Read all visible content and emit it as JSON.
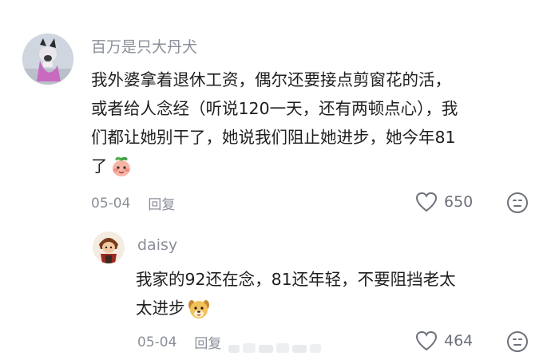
{
  "comments": [
    {
      "username": "百万是只大丹犬",
      "text_lines": [
        "我外婆拿着退休工资，偶尔还要接点剪窗花的活，",
        "或者给人念经（听说120一天，还有两顿点心），我",
        "们都让她别干了，她说我们阻止她进步，她今年81",
        "了"
      ],
      "emoji": "peach-face-emoji",
      "date": "05-04",
      "reply_label": "回复",
      "likes": "650"
    },
    {
      "username": "daisy",
      "text_lines": [
        "我家的92还在念，81还年轻，不要阻挡老太",
        "太进步"
      ],
      "emoji": "dog-face-emoji",
      "date": "05-04",
      "reply_label": "回复",
      "likes": "464"
    }
  ],
  "icons": {
    "like": "heart-outline-icon",
    "react": "smiley-face-icon"
  },
  "colors": {
    "text": "#1f1f1f",
    "muted": "#8a8f99",
    "icon": "#6d717a"
  }
}
